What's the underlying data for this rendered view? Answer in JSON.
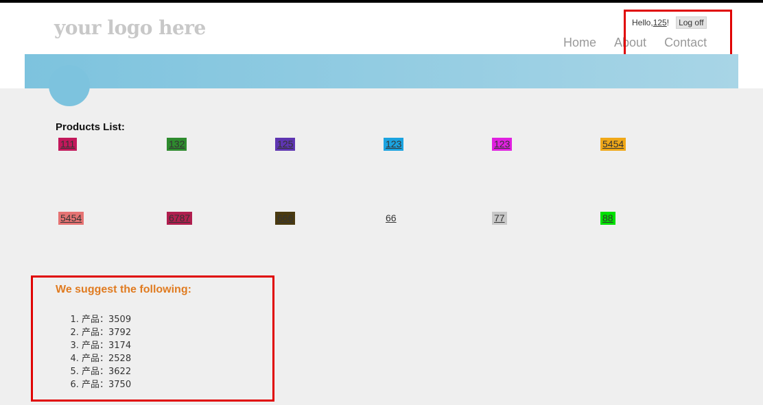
{
  "header": {
    "logo": "your logo here",
    "greeting_prefix": "Hello, ",
    "username": "125",
    "greeting_suffix": "!",
    "logoff_label": "Log off"
  },
  "nav": {
    "home": "Home",
    "about": "About",
    "contact": "Contact"
  },
  "products": {
    "title": "Products List:",
    "items": [
      {
        "label": "111",
        "color": "#c2185b"
      },
      {
        "label": "132",
        "color": "#2e8b2e"
      },
      {
        "label": "125",
        "color": "#5e35b1"
      },
      {
        "label": "123",
        "color": "#1ba3e0"
      },
      {
        "label": "123",
        "color": "#e020e0"
      },
      {
        "label": "5454",
        "color": "#f0a818"
      },
      {
        "label": "5454",
        "color": "#e57373"
      },
      {
        "label": "6787",
        "color": "#b01e4e"
      },
      {
        "label": "666",
        "color": "#4a3a10"
      },
      {
        "label": "66",
        "color": ""
      },
      {
        "label": "77",
        "color": "#c8c8c8"
      },
      {
        "label": "88",
        "color": "#00e000"
      }
    ]
  },
  "suggestions": {
    "title": "We suggest the following:",
    "items": [
      "产品：3509",
      "产品：3792",
      "产品：3174",
      "产品：2528",
      "产品：3622",
      "产品：3750"
    ]
  }
}
